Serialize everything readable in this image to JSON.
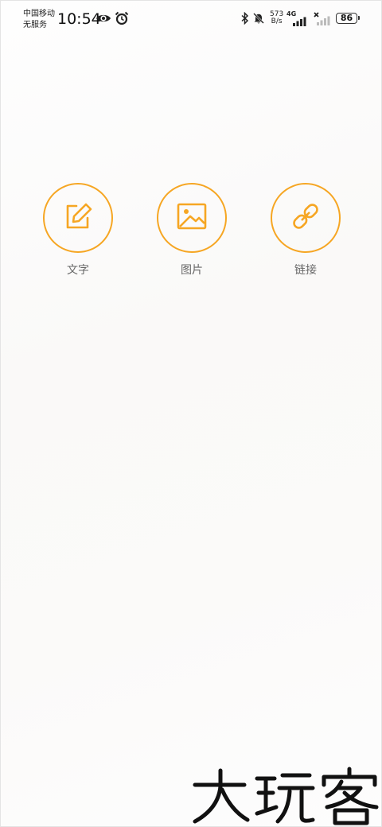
{
  "status_bar": {
    "carrier_line1": "中国移动",
    "carrier_line2": "无服务",
    "time": "10:54",
    "net_speed_value": "573",
    "net_speed_unit": "B/s",
    "network_type": "4G",
    "battery": "86",
    "icons": [
      "eye-icon",
      "alarm-icon",
      "bluetooth-icon",
      "mute-bell-icon",
      "signal-icon",
      "no-signal-icon"
    ]
  },
  "actions": [
    {
      "label": "文字",
      "icon": "edit-icon"
    },
    {
      "label": "图片",
      "icon": "image-icon"
    },
    {
      "label": "链接",
      "icon": "link-icon"
    }
  ],
  "accent_color": "#f6a623",
  "watermark": "大玩客"
}
